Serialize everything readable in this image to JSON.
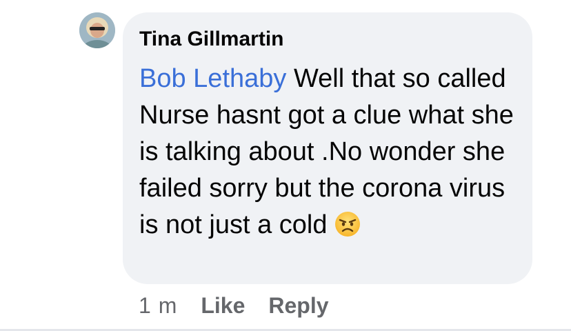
{
  "comment": {
    "author": "Tina Gillmartin",
    "mention": "Bob Lethaby",
    "text": " Well that so called Nurse hasnt got a clue what she is talking about .No wonder she failed sorry but the corona virus is not just a cold ",
    "emoji": "angry-face-icon"
  },
  "actions": {
    "time": "1 m",
    "like_label": "Like",
    "reply_label": "Reply"
  },
  "colors": {
    "bubble": "#f0f2f5",
    "mention": "#3a6fd8",
    "meta": "#65676b"
  }
}
